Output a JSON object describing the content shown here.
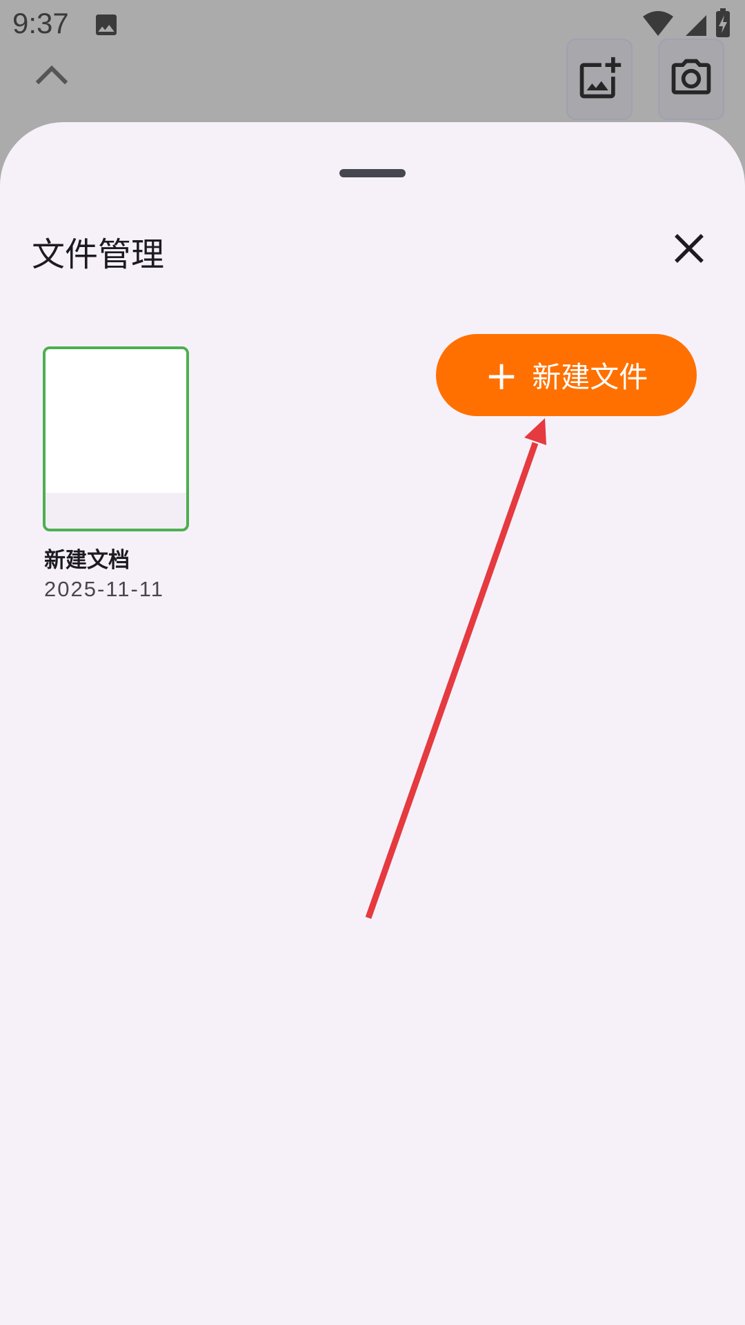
{
  "status_bar": {
    "time": "9:37"
  },
  "top_actions": {
    "add_image_icon": "add-photo-icon",
    "camera_icon": "camera-icon"
  },
  "sheet": {
    "title": "文件管理",
    "new_file_button": {
      "plus": "+",
      "label": "新建文件"
    },
    "documents": [
      {
        "name": "新建文档",
        "date": "2025-11-11"
      }
    ]
  },
  "colors": {
    "accent": "#ff7000",
    "selected_border": "#4caf50",
    "annotation_arrow": "#e53a3f",
    "sheet_bg": "#f6f1f9"
  }
}
